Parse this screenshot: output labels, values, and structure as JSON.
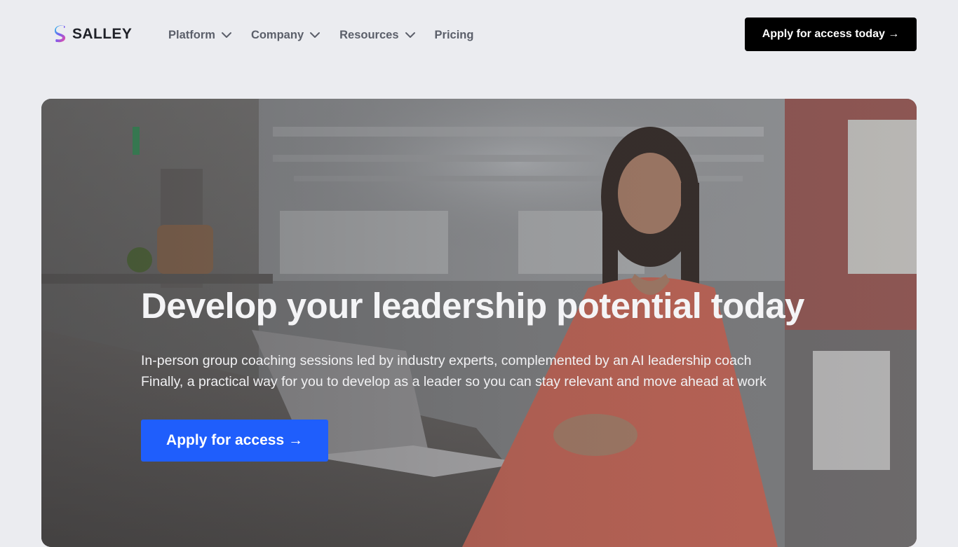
{
  "brand": {
    "name": "SALLEY"
  },
  "nav": {
    "items": [
      {
        "label": "Platform",
        "has_dropdown": true
      },
      {
        "label": "Company",
        "has_dropdown": true
      },
      {
        "label": "Resources",
        "has_dropdown": true
      },
      {
        "label": "Pricing",
        "has_dropdown": false
      }
    ]
  },
  "header": {
    "cta_label": "Apply for access today →"
  },
  "hero": {
    "title": "Develop your leadership potential today",
    "subtitle_lines": [
      "In-person group coaching sessions led by industry experts, complemented by an AI leadership coach",
      "Finally, a practical way for you to develop as a leader so you can stay relevant and move ahead at work"
    ],
    "cta_label": "Apply for access →"
  },
  "colors": {
    "page_bg": "#ebecf0",
    "header_cta_bg": "#000000",
    "hero_cta_bg": "#1f5efc",
    "text_dark": "#1f2128",
    "nav_text": "#5b5f6a"
  }
}
